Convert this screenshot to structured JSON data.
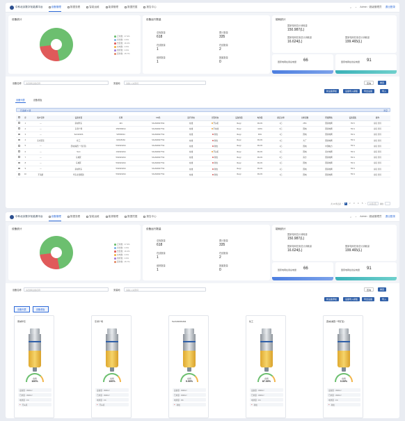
{
  "app": {
    "logo_text": "中科北京数字化能源平台",
    "nav": [
      "设备管理",
      "数据查看",
      "智能运维",
      "能源管理",
      "数据挖掘",
      "报告中心"
    ],
    "user": "Admin · 超级管理员",
    "logout": "退出登录"
  },
  "summary": {
    "pie_title": "设备统计",
    "legend": [
      {
        "label": "正常数 : 47.9%",
        "color": "#6cbf6f"
      },
      {
        "label": "离线数 : 0.0%",
        "color": "#7fb3e8"
      },
      {
        "label": "告警数 : 26.4%",
        "color": "#e05a5a"
      },
      {
        "label": "充电数 : 0.0%",
        "color": "#f2b54a"
      },
      {
        "label": "维修数 : 0.0%",
        "color": "#a37ed8"
      },
      {
        "label": "其他数 : 25.7%",
        "color": "#e58c6a"
      }
    ],
    "count_title": "设备运行数量",
    "counts": [
      {
        "k": "总库数量",
        "v": "618"
      },
      {
        "k": "累计数量",
        "v": "335"
      },
      {
        "k": "在线数量",
        "v": "1"
      },
      {
        "k": "在线数量",
        "v": "2"
      },
      {
        "k": "维修数量",
        "v": "1"
      },
      {
        "k": "报废数量",
        "v": "0"
      }
    ],
    "energy_title": "能耗统计",
    "energy": [
      {
        "k": "国家电网总计消耗量",
        "v": "150.987(L)"
      },
      {
        "k": "国家电网在用总计消耗量",
        "v": "16.624(L)"
      },
      {
        "k": "国家电网在用总计消耗量",
        "v": "199.465(L)"
      }
    ],
    "waves": [
      {
        "k": "国家电网在用总电量",
        "v": "66"
      },
      {
        "k": "国家电网在线总电量",
        "v": "91"
      }
    ]
  },
  "filter": {
    "label1": "设备名称",
    "placeholder1": "请选择设备名称",
    "label2": "安装地",
    "placeholder2": "请输入关键词",
    "search": "查询",
    "reset": "重置",
    "b1": "新设备添加",
    "b2": "设备导入模板",
    "b3": "导出设备",
    "b4": "导入"
  },
  "tabs": {
    "t1": "设备列表",
    "t2": "设备看板"
  },
  "selected_bar": {
    "text": "已选择 0 项",
    "clear": "清空"
  },
  "table": {
    "headers": [
      "",
      "序",
      "客户名称",
      "设备位置",
      "名称",
      "SN码",
      "运行状态",
      "告警状态",
      "设备容量",
      "电池量",
      "额定功率",
      "功率因数",
      "所属网格",
      "设备采集",
      "操作"
    ],
    "rows": [
      [
        "",
        "1",
        "—",
        "南城华东",
        "4#1",
        "ShoS000273S4",
        "在线",
        "开关机",
        "0kvgr",
        "99.2%",
        "1万",
        "25%",
        "国家电网",
        "TR-5",
        "编辑 删除"
      ],
      [
        "",
        "2",
        "—",
        "东邻广场",
        "25S5S54S4",
        "ShoS000277S4",
        "在线",
        "不在线",
        "0kvgr",
        "100%",
        "0万",
        "国电",
        "国家电网",
        "TR-S",
        "编辑 删除"
      ],
      [
        "",
        "3",
        "—",
        "Tech2023S",
        "525S54S4",
        "ShoS000277S4",
        "在线",
        "离线",
        "0kvgr",
        "66%",
        "1万",
        "国电",
        "国家电网",
        "TR-S",
        "编辑 删除"
      ],
      [
        "",
        "4",
        "东方医院",
        "化工",
        "N0S454S4",
        "ShoS000277S4",
        "在线",
        "离线",
        "0kvgr",
        "99.2%",
        "1万",
        "大厂",
        "国家电网",
        "TR-S",
        "编辑 删除"
      ],
      [
        "",
        "5",
        "—",
        "西城(湖西一号矿区)",
        "5S4S4S4S4",
        "ShoS000277S4",
        "在线",
        "离线",
        "0kvgr",
        "99.2%",
        "1万",
        "国电",
        "中国电力",
        "TR-S",
        "编辑 删除"
      ],
      [
        "",
        "6",
        "—",
        "5m4",
        "1S4S4S4S4",
        "ShoS000277S4",
        "在线",
        "开关机",
        "0kvgr",
        "99.2%",
        "1万",
        "国电",
        "南方电网",
        "TR-S",
        "编辑 删除"
      ],
      [
        "",
        "7",
        "—",
        "东城区",
        "5S4S4S4S4",
        "ShoS000277S4",
        "在线",
        "离线",
        "0kvgr",
        "99.2%",
        "0万",
        "南方",
        "国家电网",
        "TR-S",
        "编辑 删除"
      ],
      [
        "",
        "8",
        "—",
        "东城区",
        "5S4S4S4S4",
        "ShoS000277S4",
        "在线",
        "离线",
        "0kvgr",
        "99.2%",
        "1万",
        "国电",
        "国家电网",
        "TR-S",
        "编辑 删除"
      ],
      [
        "",
        "9",
        "—",
        "南城华东",
        "5S4S4S4S4",
        "ShoS000277S4",
        "在线",
        "离线",
        "0kvgr",
        "99.2%",
        "1万",
        "国电",
        "国家电网",
        "TR-S",
        "编辑 删除"
      ],
      [
        "",
        "10",
        "不清楚",
        "华东北部能源",
        "5S4S4S4S4",
        "ShoS000277S4",
        "在线",
        "离线",
        "0kvgr",
        "99.2%",
        "1万",
        "国电",
        "国家电网",
        "TR-S",
        "编辑 删除"
      ]
    ],
    "pager": {
      "total": "共 10 条记录",
      "pages": [
        "1",
        "2",
        "3",
        "4",
        "5"
      ],
      "size": "10条/页",
      "goto": "前往"
    }
  },
  "cards": [
    {
      "name": "南城华东",
      "pct": "100%",
      "state": "在线",
      "r1": "设备量 : 3990m³",
      "r2": "已用量 : 3990m³",
      "r3": "电池量 : 1%",
      "status": "开关机"
    },
    {
      "name": "东邻广场",
      "pct": "100%",
      "state": "在线",
      "r1": "设备量 : 3990m³",
      "r2": "已用量 : 3990m³",
      "r3": "电池量 : 1%",
      "status": "开关机"
    },
    {
      "name": "Tech2023S4S4",
      "pct": "0.00%",
      "state": "在线",
      "r1": "设备量 : 3990m³",
      "r2": "已用量 : 3990m³",
      "r3": "电池量 : 0%",
      "status": "离线"
    },
    {
      "name": "化工",
      "pct": "87.00%",
      "state": "在线",
      "r1": "设备量 : 3990m³",
      "r2": "已用量 : 3990m³",
      "r3": "电池量 : 1%",
      "status": "离线"
    },
    {
      "name": "西城(湖西一号矿区)",
      "pct": "0.00%",
      "state": "在线",
      "r1": "设备量 : 3990m³",
      "r2": "已用量 : 3990m³",
      "r3": "电池量 : 1%",
      "status": "离线"
    }
  ]
}
